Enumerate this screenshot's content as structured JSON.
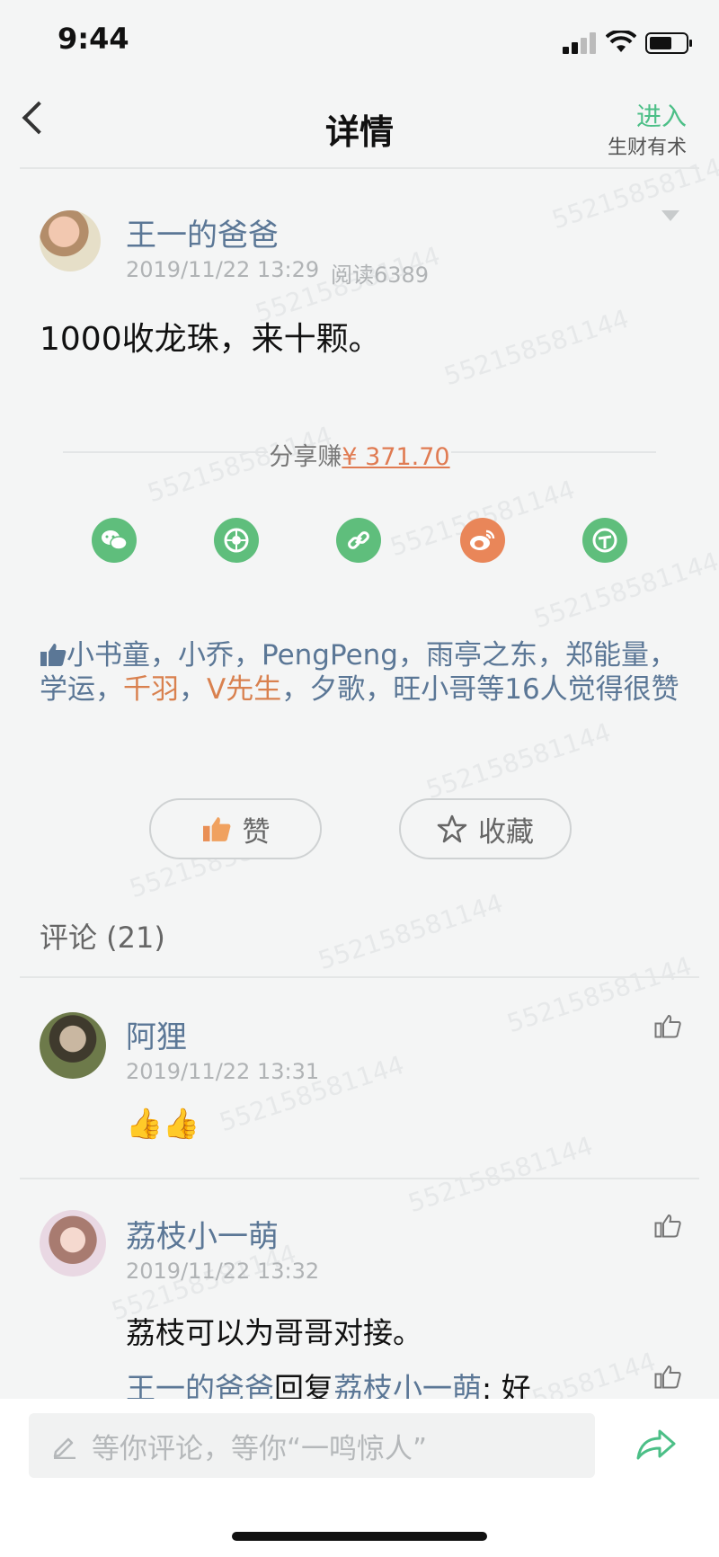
{
  "status": {
    "time": "9:44"
  },
  "nav": {
    "title": "详情",
    "enter": "进入",
    "group": "生财有术"
  },
  "post": {
    "author": "王一的爸爸",
    "date": "2019/11/22 13:29",
    "reads": "阅读6389",
    "text": "1000收龙珠，来十颗。"
  },
  "share": {
    "label": "分享赚",
    "amount": "¥ 371.70",
    "buttons": [
      "wechat-icon",
      "moments-icon",
      "link-icon",
      "weibo-icon",
      "miniprogram-icon"
    ]
  },
  "likes": {
    "names": [
      {
        "name": "小书童",
        "sep": "，",
        "highlight": false
      },
      {
        "name": "小乔",
        "sep": "，",
        "highlight": false
      },
      {
        "name": "PengPeng",
        "sep": "，",
        "highlight": false
      },
      {
        "name": "雨亭之东",
        "sep": "，",
        "highlight": false
      },
      {
        "name": "郑能量",
        "sep": "，",
        "highlight": false
      },
      {
        "name": "学运",
        "sep": "，",
        "highlight": false
      },
      {
        "name": "千羽",
        "sep": "，",
        "highlight": true
      },
      {
        "name": "V先生",
        "sep": "，",
        "highlight": true
      },
      {
        "name": "夕歌",
        "sep": "，",
        "highlight": false
      },
      {
        "name": "旺小哥",
        "sep": "",
        "highlight": false
      }
    ],
    "suffix": "等16人觉得很赞"
  },
  "actions": {
    "like": "赞",
    "favorite": "收藏"
  },
  "comments": {
    "title": "评论 (21)",
    "items": [
      {
        "author": "阿狸",
        "date": "2019/11/22 13:31",
        "text": "👍👍"
      },
      {
        "author": "荔枝小一萌",
        "date": "2019/11/22 13:32",
        "text": "荔枝可以为哥哥对接。"
      }
    ],
    "reply": {
      "from": "王一的爸爸",
      "verb": "回复",
      "to": "荔枝小一萌",
      "text": ": 好"
    }
  },
  "input": {
    "placeholder": "等你评论，等你“一鸣惊人”"
  },
  "watermark": "552158581144",
  "colors": {
    "accent_green": "#4cbf87",
    "link_blue": "#5b7796",
    "orange": "#e07b52"
  }
}
